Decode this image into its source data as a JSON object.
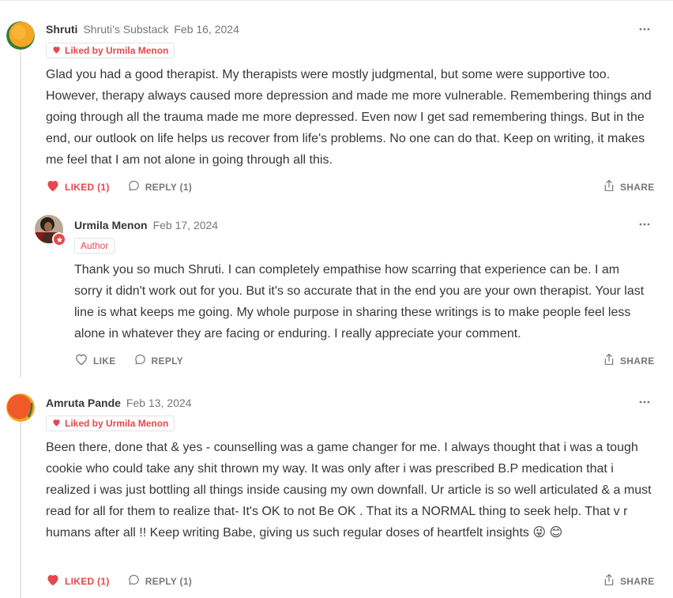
{
  "comments": [
    {
      "author": "Shruti",
      "publication": "Shruti’s Substack",
      "date": "Feb 16, 2024",
      "badge": "Liked by Urmila Menon",
      "body": "Glad you had a good therapist. My therapists were mostly judgmental, but some were supportive too. However, therapy always caused more depression and made me more vulnerable. Remembering things and going through all the trauma made me more depressed. Even now I get sad remembering things. But in the end, our outlook on life helps us recover from life's problems. No one can do that. Keep on writing, it makes me feel that I am not alone in going through all this.",
      "like_label": "LIKED (1)",
      "reply_label": "REPLY (1)",
      "share_label": "SHARE",
      "avatar_colors": [
        "#f5a623",
        "#2f7d3a"
      ]
    },
    {
      "author": "Urmila Menon",
      "date": "Feb 17, 2024",
      "badge": "Author",
      "body": "Thank you so much Shruti. I can completely empathise how scarring that experience can be. I am sorry it didn't work out for you. But it's so accurate that in the end you are your own therapist. Your last line is what keeps me going. My whole purpose in sharing these writings is to make people feel less alone in whatever they are facing or enduring. I really appreciate your comment.",
      "like_label": "LIKE",
      "reply_label": "REPLY",
      "share_label": "SHARE"
    },
    {
      "author": "Amruta Pande",
      "date": "Feb 13, 2024",
      "badge": "Liked by Urmila Menon",
      "body": "Been there, done that & yes - counselling was a game changer for me. I always thought that i was a tough cookie who could take any shit thrown my way. It was only after i was prescribed B.P medication that i realized i was just bottling all things inside causing my own downfall. Ur article is so well articulated & a must read for all for them to realize that- It's OK to not Be OK . That its a NORMAL thing to seek help. That v r humans after all !! Keep writing Babe, giving us such regular doses of heartfelt insights",
      "emojis": [
        "😜",
        "😊"
      ],
      "like_label": "LIKED (1)",
      "reply_label": "REPLY (1)",
      "share_label": "SHARE",
      "avatar_colors": [
        "#f05a28",
        "#f5a623"
      ]
    }
  ],
  "colors": {
    "accent": "#e5484d",
    "text": "#363737",
    "muted": "#777777",
    "border": "#e3e3e3"
  },
  "icons": [
    "heart-icon",
    "comment-icon",
    "share-icon",
    "more-icon",
    "star-icon"
  ]
}
